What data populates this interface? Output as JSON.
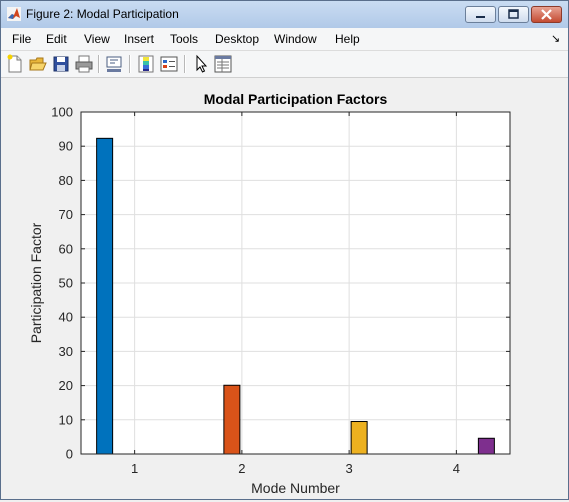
{
  "window": {
    "title": "Figure 2: Modal Participation",
    "app_icon": "matlab-icon",
    "controls": [
      "minimize-icon",
      "maximize-icon",
      "close-icon"
    ]
  },
  "menubar": {
    "items": [
      "File",
      "Edit",
      "View",
      "Insert",
      "Tools",
      "Desktop",
      "Window",
      "Help"
    ]
  },
  "toolbar": {
    "buttons": [
      "new-figure-icon",
      "open-file-icon",
      "save-icon",
      "print-icon",
      "link-plot-icon",
      "insert-colorbar-icon",
      "insert-legend-icon",
      "edit-plot-icon",
      "property-inspector-icon"
    ]
  },
  "colors": {
    "bar1": "#0072bd",
    "bar2": "#d95319",
    "bar3": "#edb120",
    "bar4": "#7e2f8e"
  },
  "chart_data": {
    "type": "bar",
    "title": "Modal Participation Factors",
    "xlabel": "Mode Number",
    "ylabel": "Participation Factor",
    "categories": [
      "1",
      "2",
      "3",
      "4"
    ],
    "x": [
      1,
      2,
      3,
      4
    ],
    "values": [
      92.3,
      20.1,
      9.5,
      4.6
    ],
    "ylim": [
      0,
      100
    ],
    "xlim": [
      0.5,
      4.5
    ],
    "yticks": [
      "0",
      "10",
      "20",
      "30",
      "40",
      "50",
      "60",
      "70",
      "80",
      "90",
      "100"
    ],
    "grid": true,
    "legend": "none"
  }
}
